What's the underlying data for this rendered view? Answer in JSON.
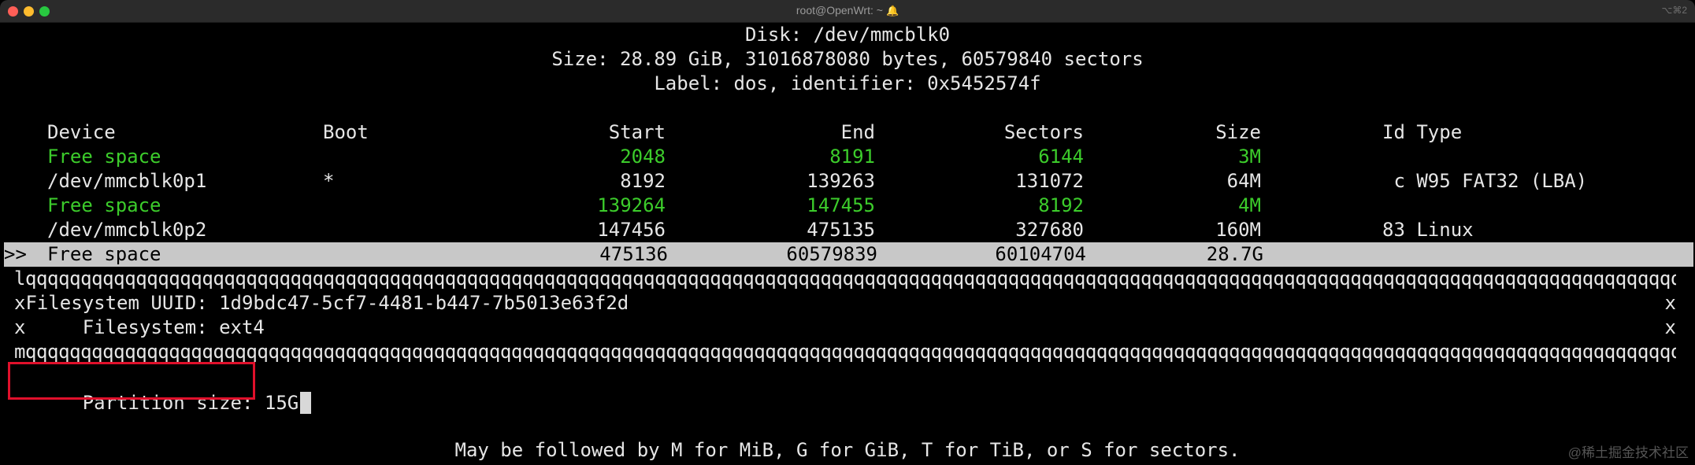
{
  "window": {
    "title": "root@OpenWrt: ~",
    "bell_icon": "bell-icon",
    "shortcut": "⌥⌘2"
  },
  "disk": {
    "name": "Disk: /dev/mmcblk0",
    "size_line": "Size: 28.89 GiB, 31016878080 bytes, 60579840 sectors",
    "label_line": "Label: dos, identifier: 0x5452574f"
  },
  "table": {
    "headers": {
      "device": "Device",
      "boot": "Boot",
      "start": "Start",
      "end": "End",
      "sectors": "Sectors",
      "size": "Size",
      "idtype": "Id Type"
    },
    "rows": [
      {
        "device": "Free space",
        "boot": "",
        "start": "2048",
        "end": "8191",
        "sectors": "6144",
        "size": "3M",
        "idtype": "",
        "free": true
      },
      {
        "device": "/dev/mmcblk0p1",
        "boot": "*",
        "start": "8192",
        "end": "139263",
        "sectors": "131072",
        "size": "64M",
        "idtype": " c W95 FAT32 (LBA)",
        "free": false
      },
      {
        "device": "Free space",
        "boot": "",
        "start": "139264",
        "end": "147455",
        "sectors": "8192",
        "size": "4M",
        "idtype": "",
        "free": true
      },
      {
        "device": "/dev/mmcblk0p2",
        "boot": "",
        "start": "147456",
        "end": "475135",
        "sectors": "327680",
        "size": "160M",
        "idtype": "83 Linux",
        "free": false
      },
      {
        "device": "Free space",
        "boot": "",
        "start": "475136",
        "end": "60579839",
        "sectors": "60104704",
        "size": "28.7G",
        "idtype": "",
        "free": false,
        "selected": true
      }
    ],
    "selection_marker": ">>"
  },
  "info_box": {
    "top_border": "lqqqqqqqqqqqqqqqqqqqqqqqqqqqqqqqqqqqqqqqqqqqqqqqqqqqqqqqqqqqqqqqqqqqqqqqqqqqqqqqqqqqqqqqqqqqqqqqqqqqqqqqqqqqqqqqqqqqqqqqqqqqqqqqqqqqqqqqqqqqqqqqqqqqqqqqqqqqqqqk",
    "line1": "xFilesystem UUID: 1d9bdc47-5cf7-4481-b447-7b5013e63f2d",
    "line2": "x     Filesystem: ext4",
    "right_edge": "x",
    "bottom_border": "mqqqqqqqqqqqqqqqqqqqqqqqqqqqqqqqqqqqqqqqqqqqqqqqqqqqqqqqqqqqqqqqqqqqqqqqqqqqqqqqqqqqqqqqqqqqqqqqqqqqqqqqqqqqqqqqqqqqqqqqqqqqqqqqqqqqqqqqqqqqqqqqqqqqqqqqqqqqqqqqj"
  },
  "prompt": {
    "label": "Partition size: ",
    "value": "15G"
  },
  "hint": "May be followed by M for MiB, G for GiB, T for TiB, or S for sectors.",
  "watermark": "@稀土掘金技术社区",
  "colors": {
    "free_space": "#3ccc2b",
    "highlight": "#c8c8c8",
    "annotation_box": "#e0102b"
  }
}
